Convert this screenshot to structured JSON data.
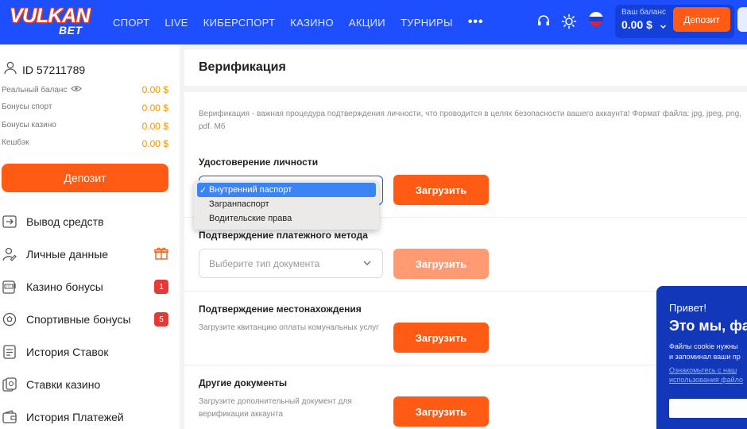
{
  "header": {
    "logo_main": "VULKAN",
    "logo_sub": "BET",
    "nav": [
      "СПОРТ",
      "LIVE",
      "КИБЕРСПОРТ",
      "КАЗИНО",
      "АКЦИИ",
      "ТУРНИРЫ"
    ],
    "more": "•••",
    "balance_label": "Ваш баланс",
    "balance_value": "0.00 $",
    "deposit_label": "Депозит",
    "colors": {
      "bar": "#1d4fff",
      "accent": "#ff5b14"
    }
  },
  "sidebar": {
    "user_id": "ID 57211789",
    "balances": [
      {
        "label": "Реальный баланс",
        "value": "0.00 $"
      },
      {
        "label": "Бонусы спорт",
        "value": "0.00 $"
      },
      {
        "label": "Бонусы казино",
        "value": "0.00 $"
      },
      {
        "label": "Кешбэк",
        "value": "0.00 $"
      }
    ],
    "deposit_label": "Депозит",
    "menu": [
      {
        "label": "Вывод средств",
        "icon": "withdraw-icon"
      },
      {
        "label": "Личные данные",
        "icon": "user-edit-icon"
      },
      {
        "label": "Казино бонусы",
        "icon": "slot-machine-icon",
        "badge": "1"
      },
      {
        "label": "Спортивные бонусы",
        "icon": "ball-icon",
        "badge": "5"
      },
      {
        "label": "История Ставок",
        "icon": "list-icon"
      },
      {
        "label": "Ставки казино",
        "icon": "casino-chip-icon"
      },
      {
        "label": "История Платежей",
        "icon": "wallet-icon"
      }
    ]
  },
  "main": {
    "title": "Верификация",
    "description": "Верификация - важная процедура подтверждения личности, что проводится в целях безопасности вашего аккаунта! Формат файла: jpg, jpeg, png, pdf. Мб",
    "upload_label": "Загрузить",
    "sections": [
      {
        "title": "Удостоверение личности"
      },
      {
        "title": "Подтверждение платежного метода",
        "placeholder": "Выберите тип документа"
      },
      {
        "title": "Подтверждение местонахождения",
        "subtitle": "Загрузите квитанцию оплаты комунальных услуг"
      },
      {
        "title": "Другие документы",
        "subtitle": "Загрузите дополнительный документ для верификации аккаунта"
      }
    ],
    "dropdown": {
      "options": [
        "Внутренний паспорт",
        "Загранпаспорт",
        "Водительские права"
      ],
      "selected": "Внутренний паспорт",
      "check": "✓"
    }
  },
  "cookie": {
    "hi": "Привет!",
    "title": "Это мы, фа",
    "text_line1": "Файлы cookie нужны",
    "text_line2": "и запоминал ваши пр",
    "link_line1": "Ознакомьтесь с наш",
    "link_line2": "использования файло"
  }
}
